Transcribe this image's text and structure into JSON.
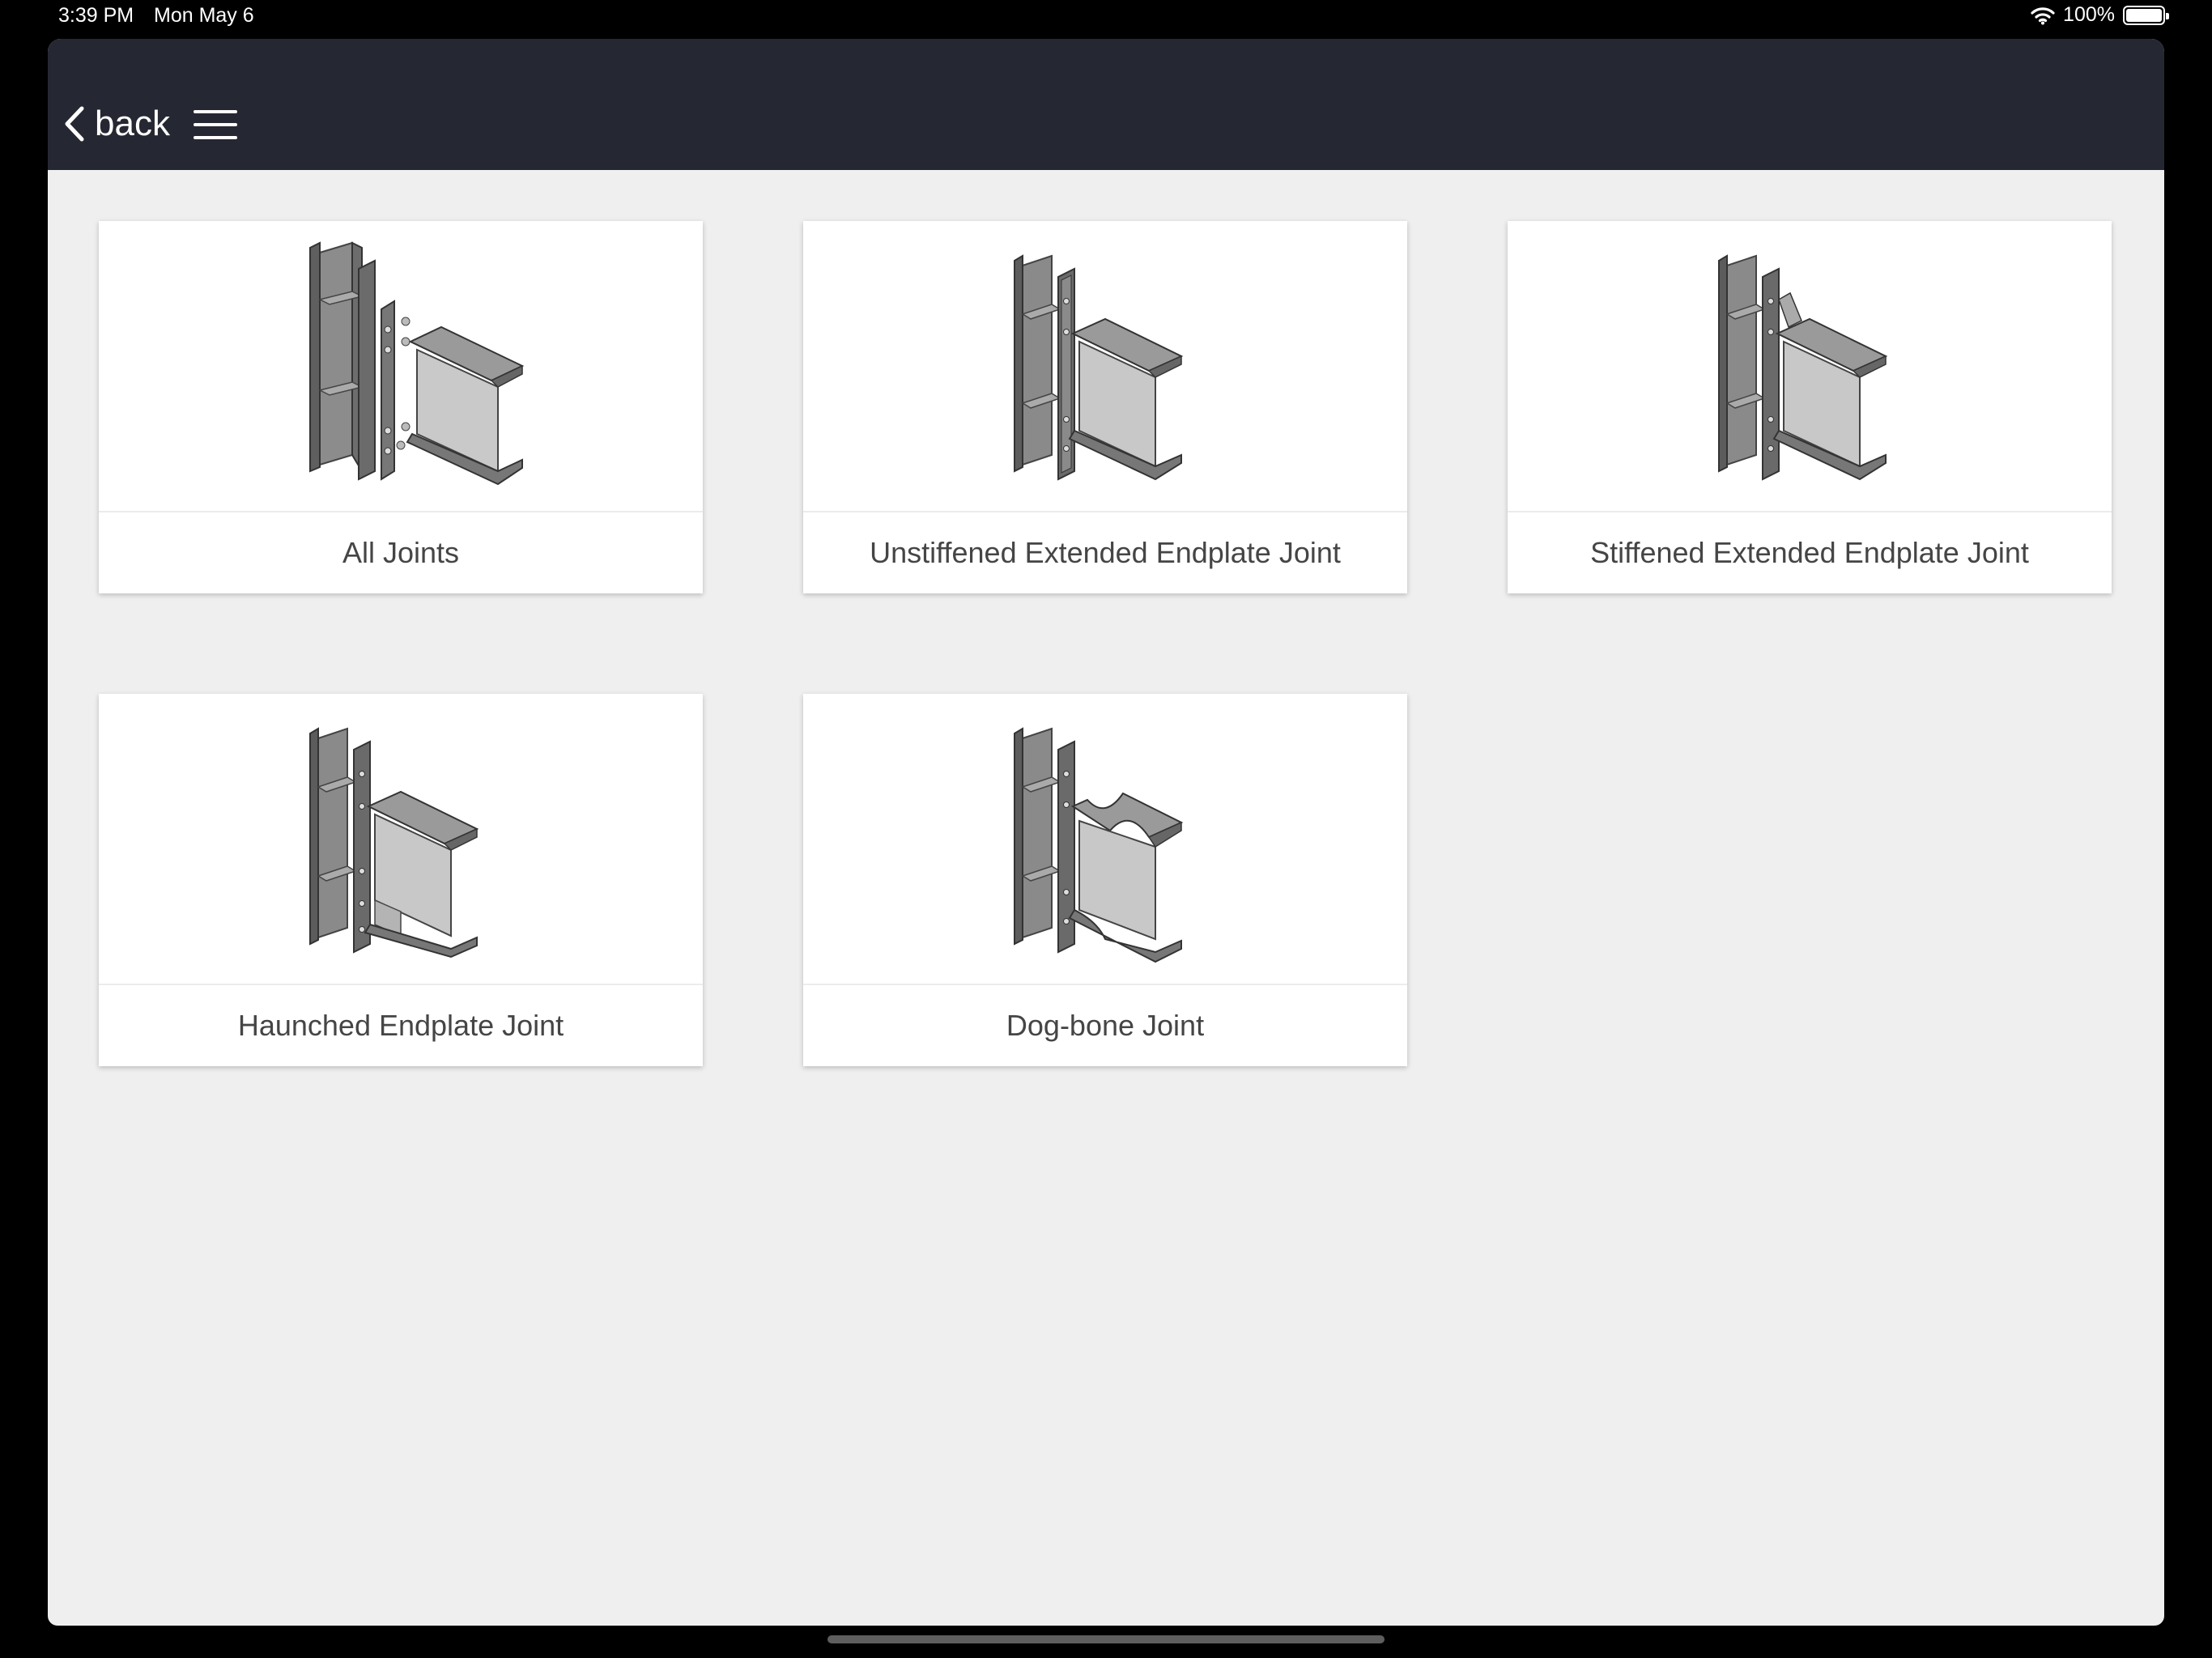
{
  "status_bar": {
    "time": "3:39 PM",
    "date": "Mon May 6",
    "battery": "100%",
    "battery_level": 1.0,
    "wifi_icon": "wifi-icon"
  },
  "nav": {
    "back_label": "back",
    "back_icon": "chevron-left-icon",
    "menu_icon": "hamburger-menu-icon"
  },
  "colors": {
    "nav_background": "#252832",
    "page_background": "#efefef",
    "card_background": "#ffffff",
    "label_text": "#454545"
  },
  "joints": [
    {
      "label": "All Joints",
      "icon": "all-joints-icon"
    },
    {
      "label": "Unstiffened Extended Endplate Joint",
      "icon": "unstiffened-endplate-joint-icon"
    },
    {
      "label": "Stiffened Extended Endplate Joint",
      "icon": "stiffened-endplate-joint-icon"
    },
    {
      "label": "Haunched Endplate Joint",
      "icon": "haunched-endplate-joint-icon"
    },
    {
      "label": "Dog-bone Joint",
      "icon": "dog-bone-joint-icon"
    }
  ]
}
